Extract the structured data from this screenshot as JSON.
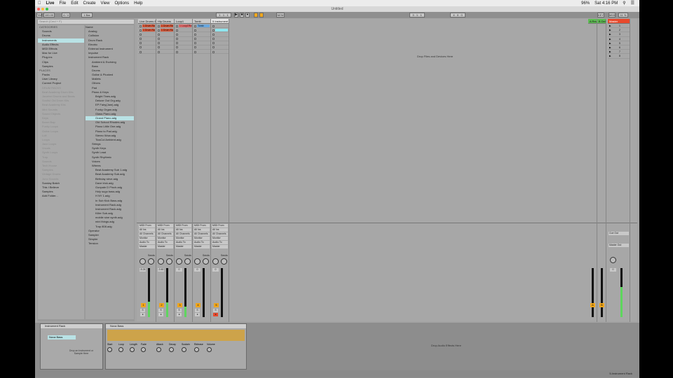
{
  "menubar": {
    "apple": "",
    "items": [
      "Live",
      "File",
      "Edit",
      "Create",
      "View",
      "Options",
      "Help"
    ],
    "battery": "96%",
    "clock": "Sat 4:16 PM"
  },
  "window": {
    "title": "Untitled"
  },
  "transport": {
    "tap": "TAP",
    "tempo": "100.00",
    "signature": "4 / 4",
    "quantize": "1 Bar",
    "position": "1 . 1 . 1",
    "loop_start": "3 . 1 . 1",
    "loop_length": "4 . 0 . 0",
    "new_label": "NEW",
    "key_label": "KEY",
    "midi_label": "MIDI",
    "cpu": "11 %"
  },
  "browser": {
    "search_placeholder": "Search (Cmd + F)",
    "categories_header": "CATEGORIES",
    "categories": [
      "Sounds",
      "Drums",
      "Instruments",
      "Audio Effects",
      "MIDI Effects",
      "Max for Live",
      "Plug-ins",
      "Clips",
      "Samples"
    ],
    "selected_category": "Instruments",
    "places_header": "PLACES",
    "places": [
      "Packs",
      "User Library",
      "Current Project",
      "DRUM RACKS",
      "Beat Academy Drum Kits",
      "Jazzfeel Drums and Beats",
      "Soulful Old Drum Kits",
      "Beat Academy Kits",
      "Mini Sounds",
      "Sound Objects",
      "Keys",
      "Boom Bap",
      "Funky Loops",
      "Guitar Loops",
      "Lofi",
      "Loops",
      "Jazz Loops",
      "Vocals",
      "Synth Loops",
      "Trap",
      "Sounds",
      "Tech House",
      "Samples",
      "Vintage Drums",
      "Juno Sounds",
      "Sunday Batch",
      "This I Believe",
      "Samples",
      "Add Folder..."
    ],
    "file_header": "Name",
    "files": [
      "Analog",
      "Collision",
      "Drum Rack",
      "Electric",
      "External Instrument",
      "Impulse",
      "Instrument Rack",
      "Ambient & Evolving",
      "Bass",
      "Drums",
      "Guitar & Plucked",
      "Mallets",
      "Others",
      "Pad",
      "Piano & Keys",
      "Bright Tines.adg",
      "Deluxe Out Org.adg",
      "EP Fairy(Jam).adg",
      "Funky Organ.adg",
      "Glass Piano.adg",
      "Grand Piano.adg",
      "Old School Rhodes.adg",
      "Piano Little One.adg",
      "Piano to Pad.adg",
      "Stereo Wow.adg",
      "TiosCol Ambient.adg",
      "Strings",
      "Synth Keys",
      "Synth Lead",
      "Synth Rhythmic",
      "Voices",
      "Wtrees",
      "Beat Academy Sub 1.adg",
      "Beat Academy Sub.adg",
      "Birthday strve.adg",
      "Dave trick.adg",
      "Gonpale D Pinch.adg",
      "Holy sugo bass.adg",
      "H NY 1.adg",
      "In Sub Kick Bass.adg",
      "Instrument Rack.adg",
      "Instrument Rack.adg",
      "Killer Sub.adg",
      "mobile sine synth.adg",
      "mini things.adg",
      "Trap 808.adg",
      "Operator",
      "Sampler",
      "Simpler",
      "Tension"
    ],
    "selected_file": "Grand Piano.adg"
  },
  "tracks": [
    {
      "name": "Live Drums 8",
      "clip": "1 Drum Ra",
      "channel": "1",
      "volume": "-5.24",
      "send": "Sends"
    },
    {
      "name": "Hip Drums",
      "clip": "1 Drum Ra",
      "channel": "2",
      "volume": "-3.60",
      "send": "Sends"
    },
    {
      "name": "Loop1",
      "clip": "1 Loop1Rnd",
      "channel": "3",
      "volume": "0",
      "send": "Sends"
    },
    {
      "name": "Tomb",
      "clip": "Tomb",
      "channel": "4",
      "volume": "0",
      "send": "Sends"
    },
    {
      "name": "5 Instrument",
      "clip": "",
      "channel": "5",
      "volume": "0",
      "send": "Sends"
    }
  ],
  "returns": [
    {
      "name": "A Rev"
    },
    {
      "name": "B Del"
    }
  ],
  "master": {
    "name": "Master",
    "scenes": [
      "1",
      "2",
      "3",
      "4",
      "5",
      "6",
      "7",
      "8"
    ],
    "volume": "0"
  },
  "drop_files": "Drop Files and Devices Here",
  "io": {
    "midi_from": "MIDI From",
    "all_ins": "All Ins",
    "all_channels": "All Channels",
    "monitor": "Monitor",
    "in": "In",
    "auto": "Auto",
    "off": "Off",
    "audio_to": "Audio To",
    "master": "Master",
    "cue_out": "Cue Out",
    "master_out": "Master Out"
  },
  "detail": {
    "rack_title": "Instrument Rack",
    "rack_chain": "Nova Bass",
    "rack_drop": "Drop an Instrument or Sample Here",
    "simpler_title": "Nova Bass",
    "simpler_params": [
      "Start",
      "Loop",
      "Length",
      "Fade",
      "Attack",
      "Decay",
      "Sustain",
      "Release",
      "Volume"
    ],
    "fx_drop": "Drop Audio Effects Here",
    "status_right": "5-Instrument Rack"
  }
}
